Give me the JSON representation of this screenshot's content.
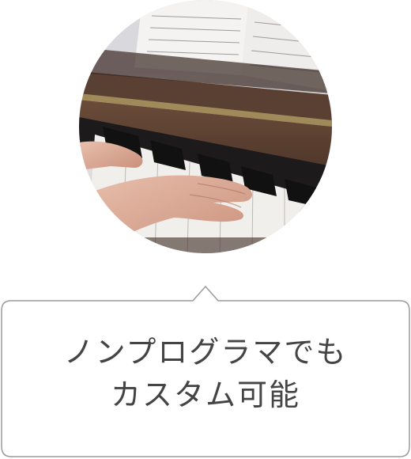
{
  "photo": {
    "icon": "piano-hands-photo"
  },
  "caption": {
    "line1": "ノンプログラマでも",
    "line2": "カスタム可能"
  },
  "colors": {
    "text": "#444444",
    "bubble_border": "#9a9a9a",
    "background": "#ffffff"
  }
}
